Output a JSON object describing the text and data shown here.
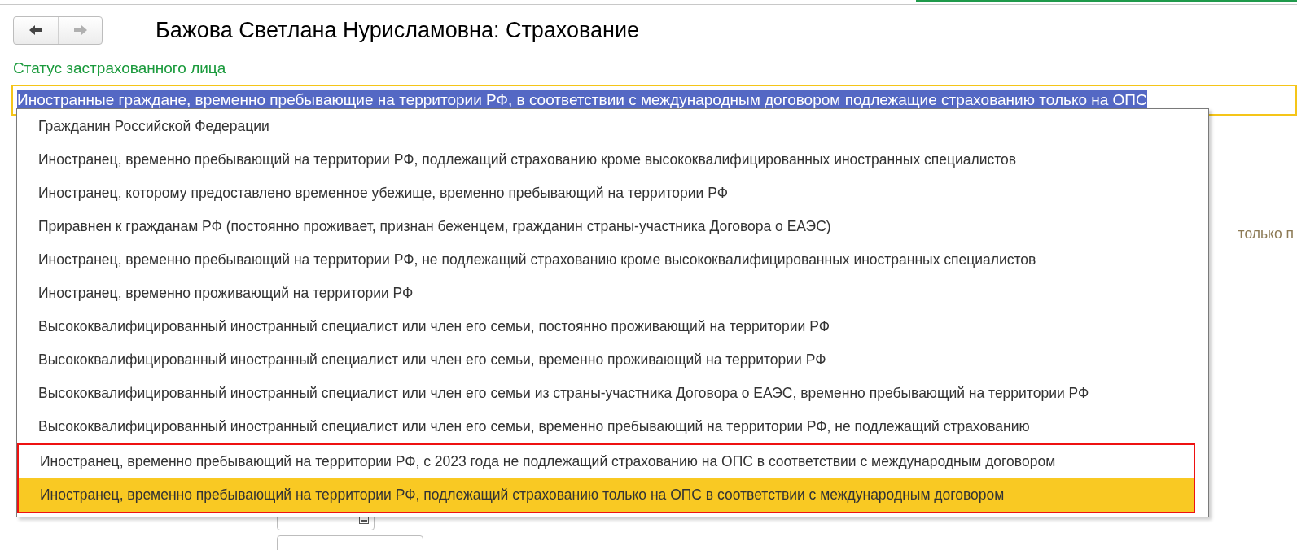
{
  "nav": {
    "back_disabled": false,
    "forward_disabled": true
  },
  "title": "Бажова Светлана Нурисламовна: Страхование",
  "status_field": {
    "label": "Статус застрахованного лица",
    "value": "Иностранные граждане, временно пребывающие на территории РФ, в соответствии с международным договором подлежащие страхованию только на ОПС"
  },
  "hidden_text_fragment": "только п",
  "dropdown": {
    "items": [
      {
        "label": "Гражданин Российской Федерации",
        "selected": false,
        "highlighted": false
      },
      {
        "label": "Иностранец, временно пребывающий на территории РФ, подлежащий страхованию кроме высококвалифицированных иностранных специалистов",
        "selected": false,
        "highlighted": false
      },
      {
        "label": "Иностранец, которому предоставлено временное убежище, временно пребывающий на территории РФ",
        "selected": false,
        "highlighted": false
      },
      {
        "label": "Приравнен к гражданам РФ (постоянно проживает, признан беженцем, гражданин страны-участника Договора о ЕАЭС)",
        "selected": false,
        "highlighted": false
      },
      {
        "label": "Иностранец, временно пребывающий на территории РФ, не подлежащий страхованию кроме высококвалифицированных иностранных специалистов",
        "selected": false,
        "highlighted": false
      },
      {
        "label": "Иностранец, временно проживающий на территории РФ",
        "selected": false,
        "highlighted": false
      },
      {
        "label": "Высококвалифицированный иностранный специалист или член его семьи, постоянно проживающий на территории РФ",
        "selected": false,
        "highlighted": false
      },
      {
        "label": "Высококвалифицированный иностранный специалист или член его семьи, временно проживающий на территории РФ",
        "selected": false,
        "highlighted": false
      },
      {
        "label": "Высококвалифицированный иностранный специалист или член его семьи из страны-участника Договора о ЕАЭС, временно пребывающий на территории РФ",
        "selected": false,
        "highlighted": false
      },
      {
        "label": "Высококвалифицированный иностранный специалист или член его семьи, временно пребывающий на территории РФ, не подлежащий страхованию",
        "selected": false,
        "highlighted": false
      },
      {
        "label": "Иностранец, временно пребывающий на территории РФ, с 2023 года не подлежащий страхованию на ОПС в соответствии с международным договором",
        "selected": false,
        "highlighted": true
      },
      {
        "label": "Иностранец, временно пребывающий на территории РФ, подлежащий страхованию только на ОПС в соответствии с международным договором",
        "selected": true,
        "highlighted": true
      }
    ]
  },
  "disability_percent": {
    "disabled": false
  }
}
